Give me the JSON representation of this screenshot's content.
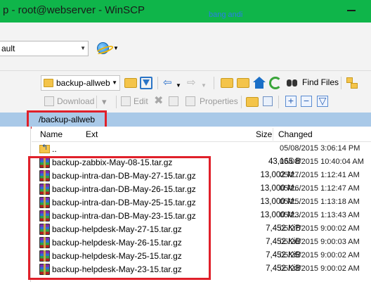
{
  "window": {
    "title": "p - root@webserver - WinSCP",
    "watermark": "bang andi"
  },
  "session": {
    "value": "ault"
  },
  "remote_toolbar": {
    "directory": "backup-allweb",
    "find_files": "Find Files",
    "download": "Download",
    "edit": "Edit",
    "properties": "Properties"
  },
  "path": "/backup-allweb",
  "columns": {
    "name": "Name",
    "ext": "Ext",
    "size": "Size",
    "changed": "Changed"
  },
  "files": [
    {
      "name": "..",
      "size": "",
      "changed": "05/08/2015 3:06:14 PM",
      "icon": "parent-dir-icon"
    },
    {
      "name": "backup-zabbix-May-08-15.tar.gz",
      "size": "43,165 B",
      "changed": "05/08/2015 10:40:04 AM",
      "icon": "archive-icon"
    },
    {
      "name": "backup-intra-dan-DB-May-27-15.tar.gz",
      "size": "13,002 M...",
      "changed": "05/27/2015 1:12:41 AM",
      "icon": "archive-icon"
    },
    {
      "name": "backup-intra-dan-DB-May-26-15.tar.gz",
      "size": "13,000 M...",
      "changed": "05/26/2015 1:12:47 AM",
      "icon": "archive-icon"
    },
    {
      "name": "backup-intra-dan-DB-May-25-15.tar.gz",
      "size": "13,000 M...",
      "changed": "05/25/2015 1:13:18 AM",
      "icon": "archive-icon"
    },
    {
      "name": "backup-intra-dan-DB-May-23-15.tar.gz",
      "size": "13,000 M...",
      "changed": "05/23/2015 1:13:43 AM",
      "icon": "archive-icon"
    },
    {
      "name": "backup-helpdesk-May-27-15.tar.gz",
      "size": "7,452 KiB",
      "changed": "05/27/2015 9:00:02 AM",
      "icon": "archive-icon"
    },
    {
      "name": "backup-helpdesk-May-26-15.tar.gz",
      "size": "7,452 KiB",
      "changed": "05/26/2015 9:00:03 AM",
      "icon": "archive-icon"
    },
    {
      "name": "backup-helpdesk-May-25-15.tar.gz",
      "size": "7,452 KiB",
      "changed": "05/25/2015 9:00:02 AM",
      "icon": "archive-icon"
    },
    {
      "name": "backup-helpdesk-May-23-15.tar.gz",
      "size": "7,452 KiB",
      "changed": "05/23/2015 9:00:02 AM",
      "icon": "archive-icon"
    }
  ],
  "colors": {
    "titlebar": "#0fb54a",
    "pathbar": "#a9c9e8",
    "highlight": "#e0202a"
  }
}
